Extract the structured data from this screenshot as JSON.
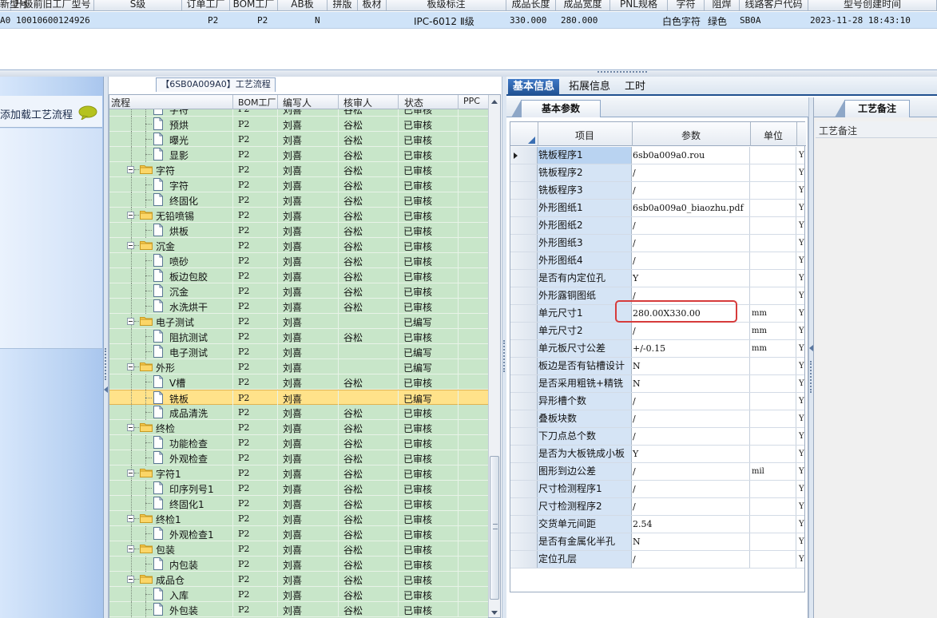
{
  "top_grid": {
    "headers": [
      "新型号",
      "升级前旧工厂型号",
      "S级",
      "订单工厂",
      "BOM工厂",
      "AB板",
      "拼版",
      "板材",
      "板级标注",
      "成品长度",
      "成品宽度",
      "PNL规格",
      "字符",
      "阻焊",
      "线路客户代码",
      "型号创建时间"
    ],
    "row": {
      "col0": "A0",
      "col1": "10010600124926",
      "order_factory": "P2",
      "bom_factory": "P2",
      "ab": "N",
      "material": "IPC-6012 Ⅱ级",
      "length": "330.000",
      "width": "280.000",
      "character": "白色字符",
      "solder_mask": "绿色",
      "customer_code": "SB0A",
      "created_time": "2023-11-28 18:43:10"
    }
  },
  "left": {
    "title_tab": "【6SB0A009A0】工艺流程",
    "load_label": "添加载工艺流程"
  },
  "tree": {
    "headers": [
      "流程",
      "BOM工厂",
      "编写人",
      "核审人",
      "状态",
      "PPC"
    ],
    "rows": [
      {
        "level": 2,
        "kind": "doc",
        "name": "字符",
        "bom": "P2",
        "writer": "刘喜",
        "auditor": "谷松",
        "status": "已审核",
        "partial": true
      },
      {
        "level": 2,
        "kind": "doc",
        "name": "预烘",
        "bom": "P2",
        "writer": "刘喜",
        "auditor": "谷松",
        "status": "已审核"
      },
      {
        "level": 2,
        "kind": "doc",
        "name": "曝光",
        "bom": "P2",
        "writer": "刘喜",
        "auditor": "谷松",
        "status": "已审核"
      },
      {
        "level": 2,
        "kind": "doc",
        "name": "显影",
        "bom": "P2",
        "writer": "刘喜",
        "auditor": "谷松",
        "status": "已审核"
      },
      {
        "level": 1,
        "kind": "folder",
        "name": "字符",
        "bom": "P2",
        "writer": "刘喜",
        "auditor": "谷松",
        "status": "已审核"
      },
      {
        "level": 2,
        "kind": "doc",
        "name": "字符",
        "bom": "P2",
        "writer": "刘喜",
        "auditor": "谷松",
        "status": "已审核"
      },
      {
        "level": 2,
        "kind": "doc",
        "name": "终固化",
        "bom": "P2",
        "writer": "刘喜",
        "auditor": "谷松",
        "status": "已审核"
      },
      {
        "level": 1,
        "kind": "folder",
        "name": "无铅喷锡",
        "bom": "P2",
        "writer": "刘喜",
        "auditor": "谷松",
        "status": "已审核"
      },
      {
        "level": 2,
        "kind": "doc",
        "name": "烘板",
        "bom": "P2",
        "writer": "刘喜",
        "auditor": "谷松",
        "status": "已审核"
      },
      {
        "level": 1,
        "kind": "folder",
        "name": "沉金",
        "bom": "P2",
        "writer": "刘喜",
        "auditor": "谷松",
        "status": "已审核"
      },
      {
        "level": 2,
        "kind": "doc",
        "name": "喷砂",
        "bom": "P2",
        "writer": "刘喜",
        "auditor": "谷松",
        "status": "已审核"
      },
      {
        "level": 2,
        "kind": "doc",
        "name": "板边包胶",
        "bom": "P2",
        "writer": "刘喜",
        "auditor": "谷松",
        "status": "已审核"
      },
      {
        "level": 2,
        "kind": "doc",
        "name": "沉金",
        "bom": "P2",
        "writer": "刘喜",
        "auditor": "谷松",
        "status": "已审核"
      },
      {
        "level": 2,
        "kind": "doc",
        "name": "水洗烘干",
        "bom": "P2",
        "writer": "刘喜",
        "auditor": "谷松",
        "status": "已审核"
      },
      {
        "level": 1,
        "kind": "folder",
        "name": "电子测试",
        "bom": "P2",
        "writer": "刘喜",
        "auditor": "",
        "status": "已编写"
      },
      {
        "level": 2,
        "kind": "doc",
        "name": "阻抗测试",
        "bom": "P2",
        "writer": "刘喜",
        "auditor": "谷松",
        "status": "已审核"
      },
      {
        "level": 2,
        "kind": "doc",
        "name": "电子测试",
        "bom": "P2",
        "writer": "刘喜",
        "auditor": "",
        "status": "已编写"
      },
      {
        "level": 1,
        "kind": "folder",
        "name": "外形",
        "bom": "P2",
        "writer": "刘喜",
        "auditor": "",
        "status": "已编写"
      },
      {
        "level": 2,
        "kind": "doc",
        "name": "V槽",
        "bom": "P2",
        "writer": "刘喜",
        "auditor": "谷松",
        "status": "已审核"
      },
      {
        "level": 2,
        "kind": "doc",
        "name": "铣板",
        "bom": "P2",
        "writer": "刘喜",
        "auditor": "",
        "status": "已编写",
        "selected": true
      },
      {
        "level": 2,
        "kind": "doc",
        "name": "成品清洗",
        "bom": "P2",
        "writer": "刘喜",
        "auditor": "谷松",
        "status": "已审核"
      },
      {
        "level": 1,
        "kind": "folder",
        "name": "终检",
        "bom": "P2",
        "writer": "刘喜",
        "auditor": "谷松",
        "status": "已审核"
      },
      {
        "level": 2,
        "kind": "doc",
        "name": "功能检查",
        "bom": "P2",
        "writer": "刘喜",
        "auditor": "谷松",
        "status": "已审核"
      },
      {
        "level": 2,
        "kind": "doc",
        "name": "外观检查",
        "bom": "P2",
        "writer": "刘喜",
        "auditor": "谷松",
        "status": "已审核"
      },
      {
        "level": 1,
        "kind": "folder",
        "name": "字符1",
        "bom": "P2",
        "writer": "刘喜",
        "auditor": "谷松",
        "status": "已审核"
      },
      {
        "level": 2,
        "kind": "doc",
        "name": "印序列号1",
        "bom": "P2",
        "writer": "刘喜",
        "auditor": "谷松",
        "status": "已审核"
      },
      {
        "level": 2,
        "kind": "doc",
        "name": "终固化1",
        "bom": "P2",
        "writer": "刘喜",
        "auditor": "谷松",
        "status": "已审核"
      },
      {
        "level": 1,
        "kind": "folder",
        "name": "终检1",
        "bom": "P2",
        "writer": "刘喜",
        "auditor": "谷松",
        "status": "已审核"
      },
      {
        "level": 2,
        "kind": "doc",
        "name": "外观检查1",
        "bom": "P2",
        "writer": "刘喜",
        "auditor": "谷松",
        "status": "已审核"
      },
      {
        "level": 1,
        "kind": "folder",
        "name": "包装",
        "bom": "P2",
        "writer": "刘喜",
        "auditor": "谷松",
        "status": "已审核"
      },
      {
        "level": 2,
        "kind": "doc",
        "name": "内包装",
        "bom": "P2",
        "writer": "刘喜",
        "auditor": "谷松",
        "status": "已审核"
      },
      {
        "level": 1,
        "kind": "folder",
        "name": "成品仓",
        "bom": "P2",
        "writer": "刘喜",
        "auditor": "谷松",
        "status": "已审核"
      },
      {
        "level": 2,
        "kind": "doc",
        "name": "入库",
        "bom": "P2",
        "writer": "刘喜",
        "auditor": "谷松",
        "status": "已审核"
      },
      {
        "level": 2,
        "kind": "doc",
        "name": "外包装",
        "bom": "P2",
        "writer": "刘喜",
        "auditor": "谷松",
        "status": "已审核"
      }
    ]
  },
  "tabs": [
    "基本信息",
    "拓展信息",
    "工时"
  ],
  "param": {
    "tab_label": "基本参数",
    "headers": [
      "项目",
      "参数",
      "单位"
    ],
    "rows": [
      {
        "item": "铣板程序1",
        "value": "6sb0a009a0.rou",
        "unit": "",
        "flag": "Y",
        "current": true
      },
      {
        "item": "铣板程序2",
        "value": "/",
        "unit": "",
        "flag": "Y"
      },
      {
        "item": "铣板程序3",
        "value": "/",
        "unit": "",
        "flag": "Y"
      },
      {
        "item": "外形图纸1",
        "value": "6sb0a009a0_biaozhu.pdf",
        "unit": "",
        "flag": "Y"
      },
      {
        "item": "外形图纸2",
        "value": "/",
        "unit": "",
        "flag": "Y"
      },
      {
        "item": "外形图纸3",
        "value": "/",
        "unit": "",
        "flag": "Y"
      },
      {
        "item": "外形图纸4",
        "value": "/",
        "unit": "",
        "flag": "Y"
      },
      {
        "item": "是否有内定位孔",
        "value": "Y",
        "unit": "",
        "flag": "Y"
      },
      {
        "item": "外形露铜图纸",
        "value": "/",
        "unit": "",
        "flag": "Y"
      },
      {
        "item": "单元尺寸1",
        "value": "280.00X330.00",
        "unit": "mm",
        "flag": "Y"
      },
      {
        "item": "单元尺寸2",
        "value": "/",
        "unit": "mm",
        "flag": "Y"
      },
      {
        "item": "单元板尺寸公差",
        "value": "+/-0.15",
        "unit": "mm",
        "flag": "Y"
      },
      {
        "item": "板边是否有钻槽设计",
        "value": "N",
        "unit": "",
        "flag": "Y"
      },
      {
        "item": "是否采用粗铣+精铣",
        "value": "N",
        "unit": "",
        "flag": "Y"
      },
      {
        "item": "异形槽个数",
        "value": "/",
        "unit": "",
        "flag": "Y"
      },
      {
        "item": "叠板块数",
        "value": "/",
        "unit": "",
        "flag": "Y"
      },
      {
        "item": "下刀点总个数",
        "value": "/",
        "unit": "",
        "flag": "Y"
      },
      {
        "item": "是否为大板铣成小板",
        "value": "Y",
        "unit": "",
        "flag": "Y"
      },
      {
        "item": "图形到边公差",
        "value": "/",
        "unit": "mil",
        "flag": "Y"
      },
      {
        "item": "尺寸检测程序1",
        "value": "/",
        "unit": "",
        "flag": "Y"
      },
      {
        "item": "尺寸检测程序2",
        "value": "/",
        "unit": "",
        "flag": "Y"
      },
      {
        "item": "交货单元间距",
        "value": "2.54",
        "unit": "",
        "flag": "Y"
      },
      {
        "item": "是否有金属化半孔",
        "value": "N",
        "unit": "",
        "flag": "Y"
      },
      {
        "item": "定位孔层",
        "value": "/",
        "unit": "",
        "flag": "Y"
      }
    ]
  },
  "memo": {
    "tab_label": "工艺备注",
    "column_label": "工艺备注"
  },
  "colors": {
    "tree_row_bg": "#c8e6c9",
    "selected_row_bg": "#ffe28a",
    "active_tab": "#1f4f8f",
    "highlight_border": "#d63b3b"
  }
}
